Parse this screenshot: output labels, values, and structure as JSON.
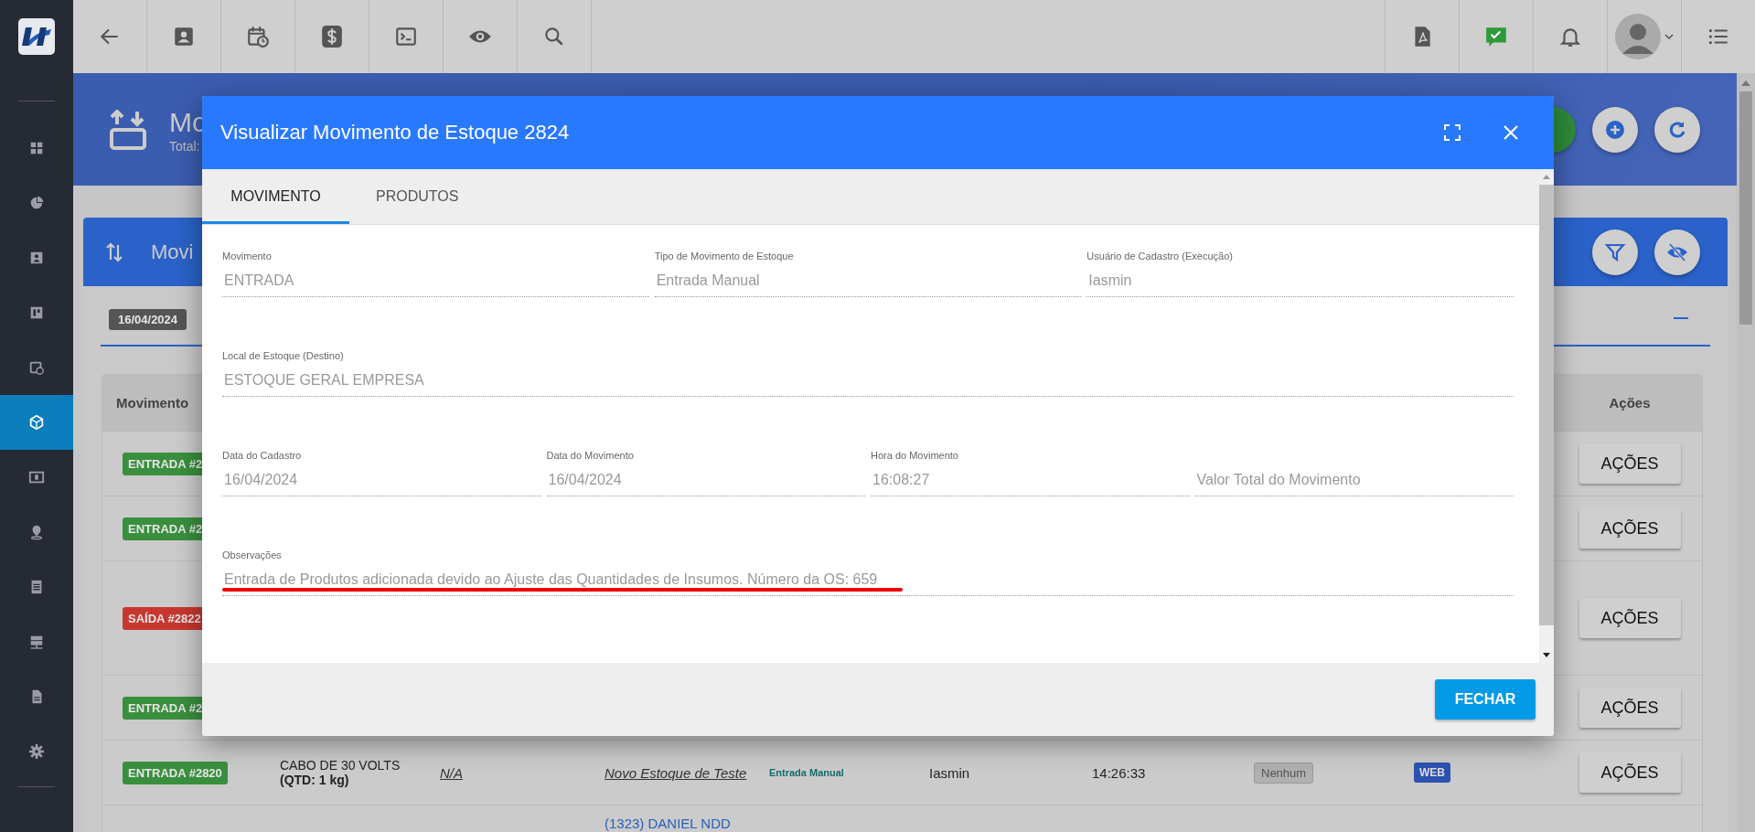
{
  "sidebar": {
    "items": [
      {
        "selected": false
      },
      {
        "selected": false
      },
      {
        "selected": false
      },
      {
        "selected": false
      },
      {
        "selected": false
      },
      {
        "selected": true
      },
      {
        "selected": false
      },
      {
        "selected": false
      },
      {
        "selected": false
      },
      {
        "selected": false
      },
      {
        "selected": false
      },
      {
        "selected": false
      }
    ]
  },
  "page_header": {
    "title": "Mo",
    "subtitle": "Total:"
  },
  "card": {
    "title": "Movi",
    "date_badge": "16/04/2024"
  },
  "table": {
    "columns": [
      "Movimento",
      "Ações"
    ],
    "rows": [
      {
        "movimento": {
          "label": "ENTRADA #2",
          "kind": "entrada"
        },
        "action": "AÇÕES"
      },
      {
        "movimento": {
          "label": "ENTRADA #2",
          "kind": "entrada"
        },
        "action": "AÇÕES"
      },
      {
        "movimento": {
          "label": "SAÍDA #2822",
          "kind": "saida"
        },
        "action": "AÇÕES"
      },
      {
        "movimento": {
          "label": "ENTRADA #2",
          "kind": "entrada"
        },
        "action": "AÇÕES"
      },
      {
        "movimento": {
          "label": "ENTRADA #2820",
          "kind": "entrada"
        },
        "product": "CABO DE 30 VOLTS",
        "quantity": "(QTD: 1 kg)",
        "column_3": "N/A",
        "stock": "Novo Estoque de Teste",
        "type": "Entrada Manual",
        "user": "Iasmin",
        "time": "14:26:33",
        "status": "Nenhum",
        "origin": "WEB",
        "action": "AÇÕES"
      },
      {
        "stock": "(1323) DANIEL NDD"
      }
    ]
  },
  "modal": {
    "title": "Visualizar Movimento de Estoque 2824",
    "tabs": [
      {
        "label": "MOVIMENTO",
        "selected": true
      },
      {
        "label": "PRODUTOS",
        "selected": false
      }
    ],
    "field_rows": [
      [
        {
          "label": "Movimento",
          "value": "ENTRADA"
        },
        {
          "label": "Tipo de Movimento de Estoque",
          "value": "Entrada Manual"
        },
        {
          "label": "Usuário de Cadastro (Execução)",
          "value": "Iasmin"
        }
      ],
      [
        {
          "label": "Local de Estoque (Destino)",
          "value": "ESTOQUE GERAL EMPRESA"
        }
      ],
      [
        {
          "label": "Data do Cadastro",
          "value": "16/04/2024"
        },
        {
          "label": "Data do Movimento",
          "value": "16/04/2024"
        },
        {
          "label": "Hora do Movimento",
          "value": "16:08:27"
        },
        {
          "placeholder": "Valor Total do Movimento"
        }
      ],
      [
        {
          "label": "Observações",
          "value": "Entrada de Produtos adicionada devido ao Ajuste das Quantidades de Insumos. Número da OS: 659",
          "underlined": true
        }
      ]
    ],
    "buttons": [
      "FECHAR"
    ]
  }
}
